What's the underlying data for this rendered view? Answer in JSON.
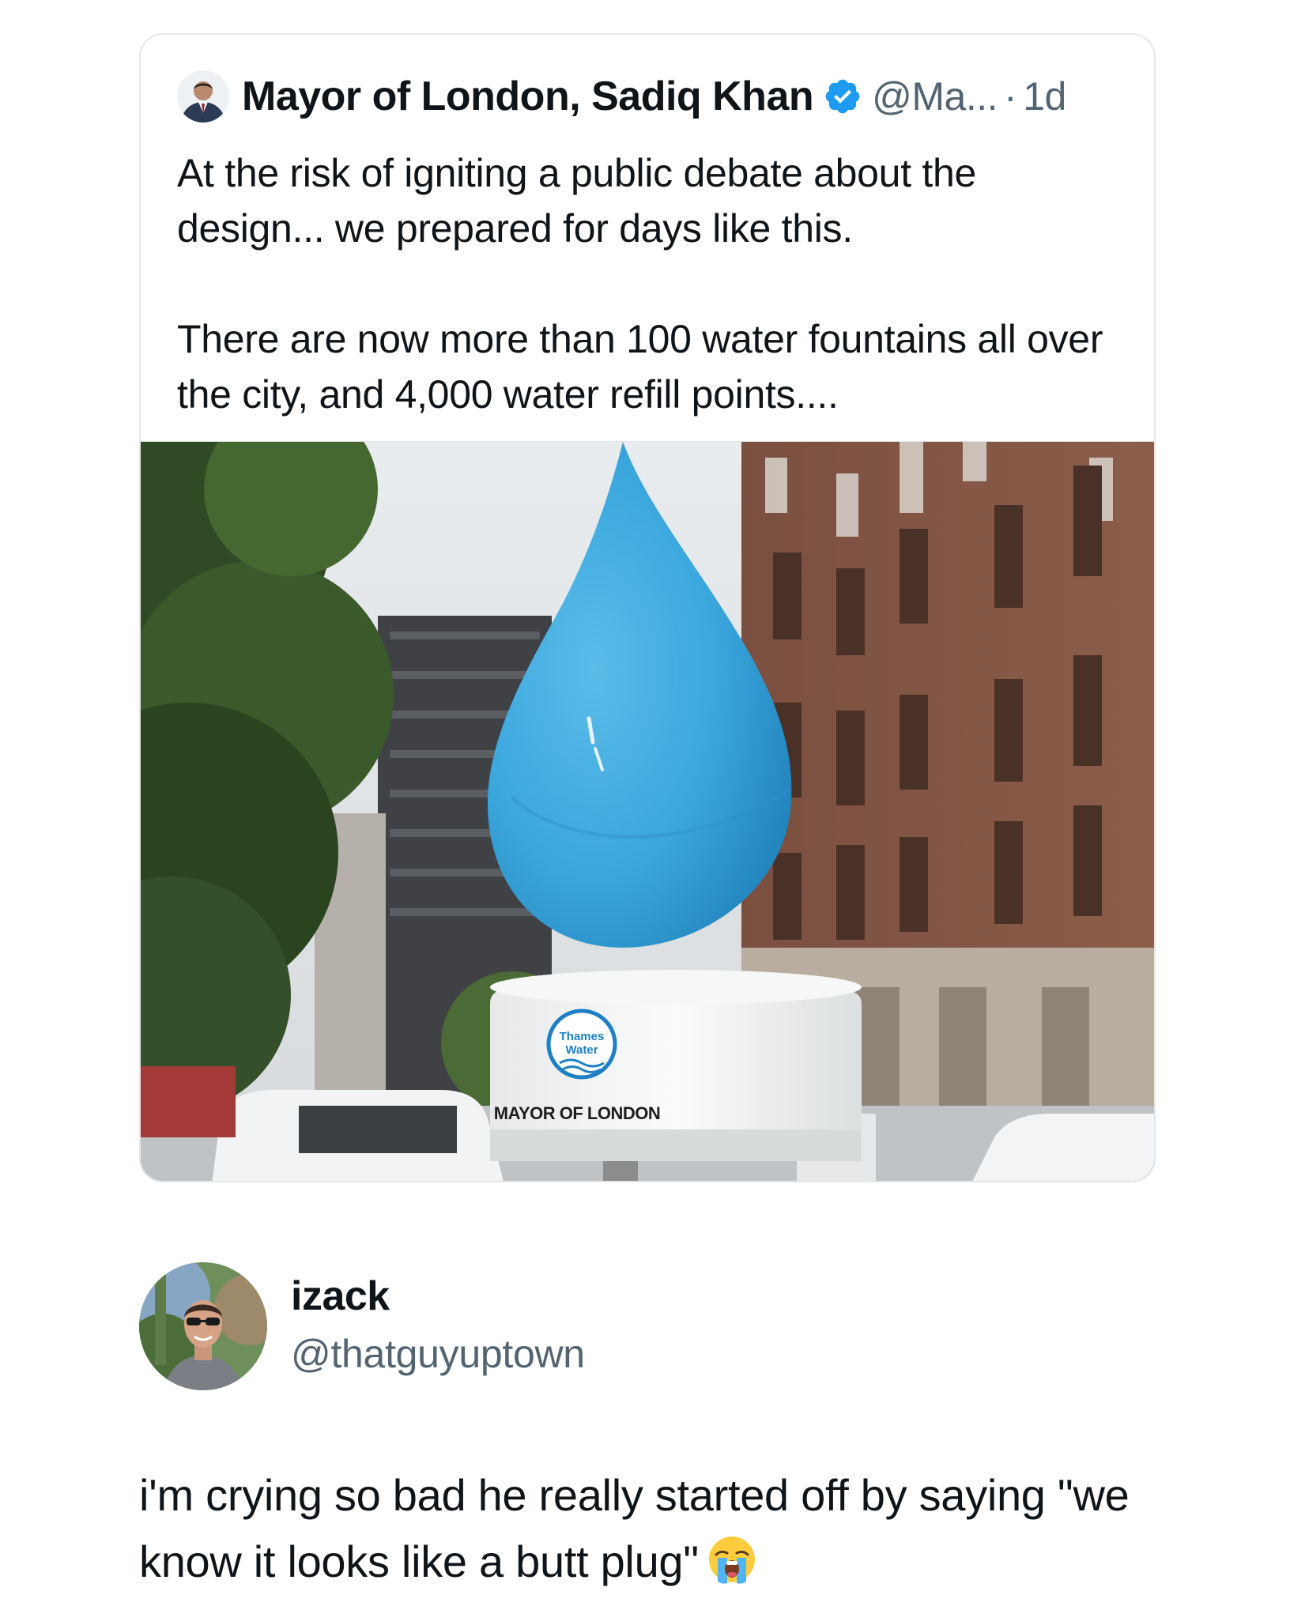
{
  "quoted_tweet": {
    "author_name": "Mayor of London, Sadiq Khan",
    "handle": "@Ma...",
    "separator": "·",
    "time": "1d",
    "avatar_icon": "person-avatar-icon",
    "verified_icon": "verified-badge-icon",
    "text_paragraphs": [
      "At the risk of igniting a public debate about the design... we prepared for days like this.",
      "There are now more than 100 water fountains all over the city, and 4,000 water refill points...."
    ],
    "media": {
      "logo_text_line1": "Thames",
      "logo_text_line2": "Water",
      "plinth_text": "MAYOR OF LONDON"
    }
  },
  "reply_tweet": {
    "author_name": "izack",
    "handle": "@thatguyuptown",
    "text": "i'm crying so bad he really started off by saying \"we know it looks like a butt plug\"",
    "emoji_icon": "loudly-crying-face-icon"
  },
  "colors": {
    "text_primary": "#0f1419",
    "text_secondary": "#536471",
    "verified_blue": "#1d9bf0",
    "drop_blue": "#3aa6dc",
    "card_border": "#e4e8eb"
  }
}
